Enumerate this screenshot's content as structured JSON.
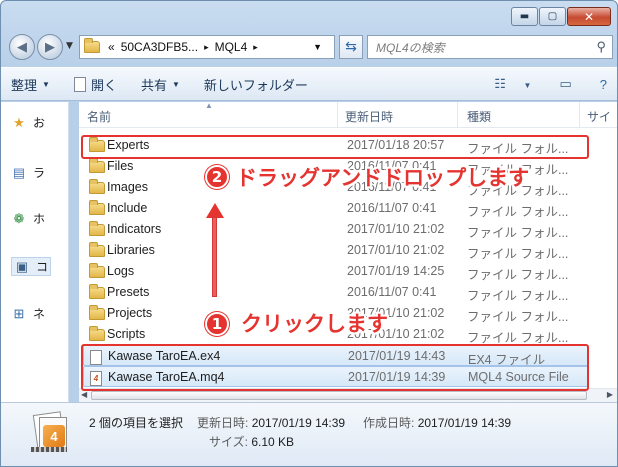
{
  "window": {
    "caption_buttons": {
      "minimize": "▬",
      "maximize": "▢",
      "close": "✕"
    }
  },
  "address_bar": {
    "overflow": "«",
    "segments": [
      "50CA3DFB5...",
      "MQL4"
    ],
    "separator": "▸"
  },
  "search": {
    "placeholder": "MQL4の検索"
  },
  "toolbar": {
    "organize": "整理",
    "open": "開く",
    "share": "共有",
    "new_folder": "新しいフォルダー"
  },
  "nav_pane": {
    "items": [
      {
        "label": "お",
        "icon": "star-icon"
      },
      {
        "label": "ラ",
        "icon": "library-icon"
      },
      {
        "label": "ホ",
        "icon": "homegroup-icon"
      },
      {
        "label": "コ",
        "icon": "computer-icon"
      },
      {
        "label": "ネ",
        "icon": "network-icon"
      }
    ]
  },
  "columns": {
    "name": "名前",
    "modified": "更新日時",
    "type": "種類",
    "size": "サイ"
  },
  "files": [
    {
      "name": "Experts",
      "date": "2017/01/18 20:57",
      "type": "ファイル フォル...",
      "kind": "folder",
      "selected": false
    },
    {
      "name": "Files",
      "date": "2016/11/07 0:41",
      "type": "ファイル フォル...",
      "kind": "folder",
      "selected": false
    },
    {
      "name": "Images",
      "date": "2016/11/07 0:41",
      "type": "ファイル フォル...",
      "kind": "folder",
      "selected": false
    },
    {
      "name": "Include",
      "date": "2016/11/07 0:41",
      "type": "ファイル フォル...",
      "kind": "folder",
      "selected": false
    },
    {
      "name": "Indicators",
      "date": "2017/01/10 21:02",
      "type": "ファイル フォル...",
      "kind": "folder",
      "selected": false
    },
    {
      "name": "Libraries",
      "date": "2017/01/10 21:02",
      "type": "ファイル フォル...",
      "kind": "folder",
      "selected": false
    },
    {
      "name": "Logs",
      "date": "2017/01/19 14:25",
      "type": "ファイル フォル...",
      "kind": "folder",
      "selected": false
    },
    {
      "name": "Presets",
      "date": "2016/11/07 0:41",
      "type": "ファイル フォル...",
      "kind": "folder",
      "selected": false
    },
    {
      "name": "Projects",
      "date": "2017/01/10 21:02",
      "type": "ファイル フォル...",
      "kind": "folder",
      "selected": false
    },
    {
      "name": "Scripts",
      "date": "2017/01/10 21:02",
      "type": "ファイル フォル...",
      "kind": "folder",
      "selected": false
    },
    {
      "name": "Kawase TaroEA.ex4",
      "date": "2017/01/19 14:43",
      "type": "EX4 ファイル",
      "kind": "file",
      "selected": true
    },
    {
      "name": "Kawase TaroEA.mq4",
      "date": "2017/01/19 14:39",
      "type": "MQL4 Source File",
      "kind": "mq4",
      "selected": true
    }
  ],
  "annotations": {
    "step1_number": "1",
    "step1_text": "クリックします",
    "step2_number": "2",
    "step2_text": "ドラッグアンドドロップします",
    "color": "#e53430"
  },
  "details": {
    "selection": "2 個の項目を選択",
    "modified_label": "更新日時:",
    "modified_value": "2017/01/19 14:39",
    "created_label": "作成日時:",
    "created_value": "2017/01/19 14:39",
    "size_label": "サイズ:",
    "size_value": "6.10 KB"
  }
}
